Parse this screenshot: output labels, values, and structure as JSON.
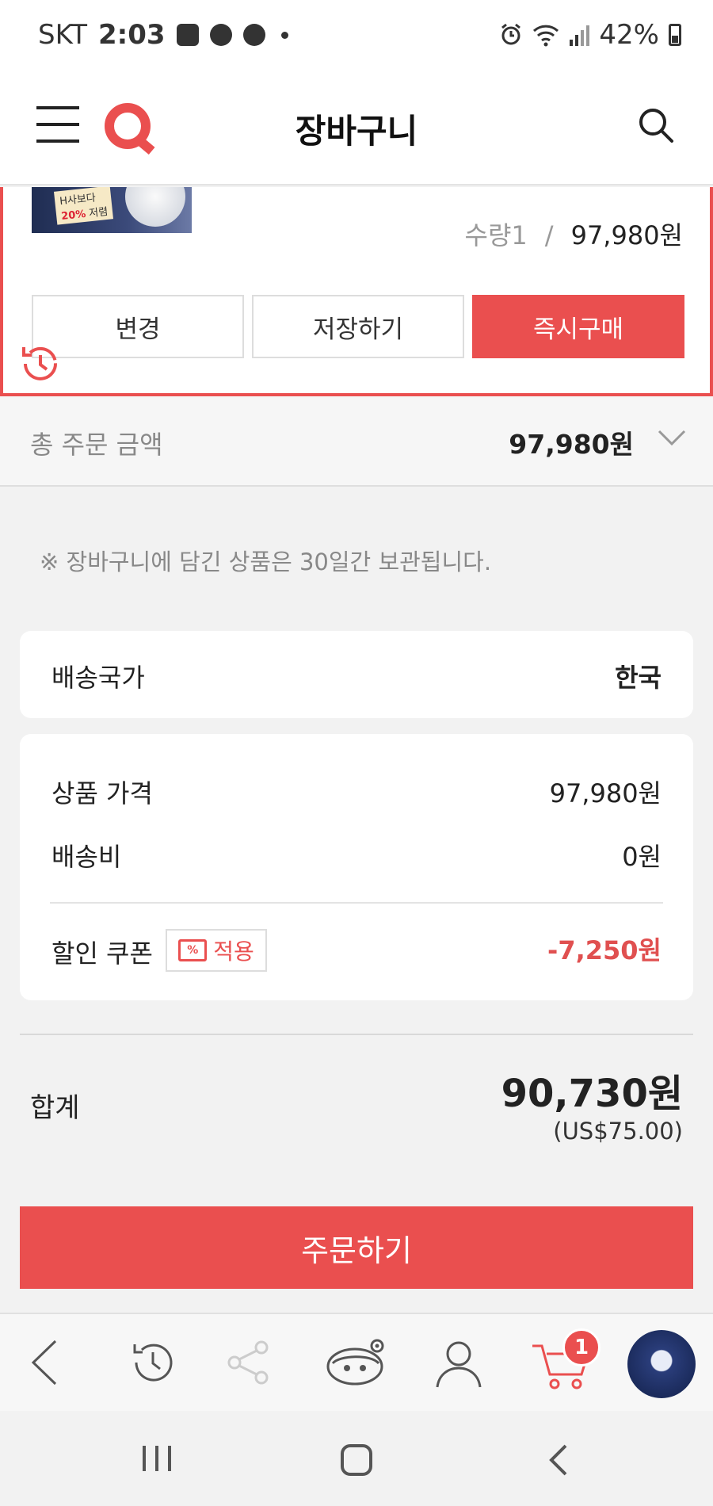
{
  "status_bar": {
    "carrier": "SKT",
    "time": "2:03",
    "battery": "42%"
  },
  "header": {
    "title": "장바구니"
  },
  "product": {
    "thumb_tag": "H사보다",
    "thumb_tag_pct": "20%",
    "thumb_tag_tail": "저렴",
    "qty": "수량1",
    "sep": "/",
    "price": "97,980원",
    "buttons": {
      "change": "변경",
      "save": "저장하기",
      "buy_now": "즉시구매"
    }
  },
  "total_order": {
    "label": "총 주문 금액",
    "amount": "97,980원"
  },
  "notice": "※ 장바구니에 담긴 상품은 30일간 보관됩니다.",
  "shipping": {
    "label": "배송국가",
    "value": "한국"
  },
  "price_breakdown": {
    "item_price_label": "상품 가격",
    "item_price": "97,980원",
    "shipping_fee_label": "배송비",
    "shipping_fee": "0원",
    "coupon_label": "할인 쿠폰",
    "coupon_apply": "적용",
    "coupon_icon_text": "%",
    "discount": "-7,250원"
  },
  "summary": {
    "label": "합계",
    "total": "90,730원",
    "usd": "(US$75.00)"
  },
  "order_button": "주문하기",
  "bottom_nav": {
    "cart_count": "1"
  },
  "colors": {
    "accent": "#ea4f4f",
    "discount": "#e05050"
  }
}
